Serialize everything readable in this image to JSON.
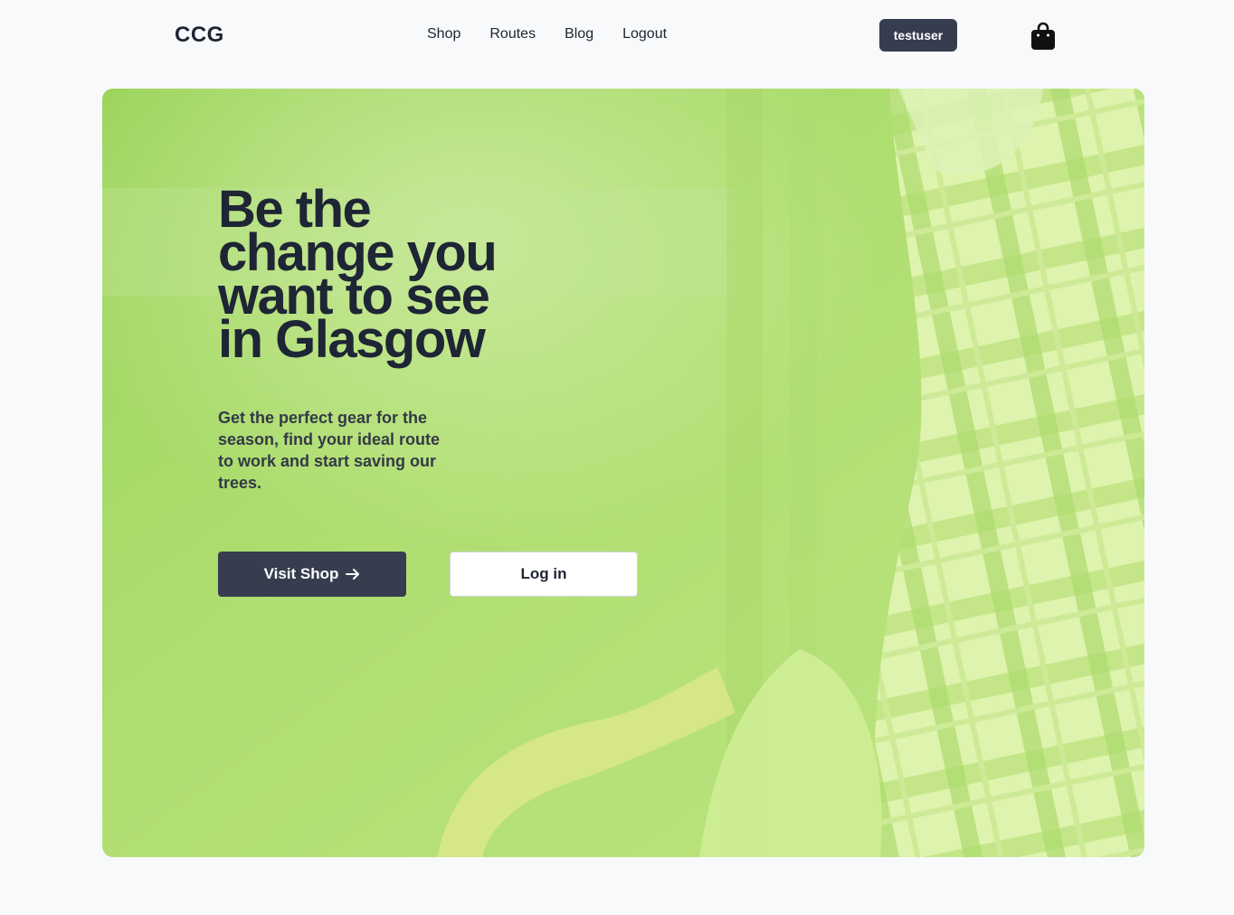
{
  "brand": {
    "logo": "CCG"
  },
  "nav": {
    "links": [
      {
        "label": "Shop"
      },
      {
        "label": "Routes"
      },
      {
        "label": "Blog"
      },
      {
        "label": "Logout"
      }
    ],
    "username": "testuser",
    "cart_icon": "shopping-bag-icon"
  },
  "hero": {
    "title": "Be the change you want to see in Glasgow",
    "subtitle": "Get the perfect gear for the season, find your ideal route to work and start saving our trees.",
    "primary_button": "Visit Shop",
    "primary_button_icon": "arrow-right-icon",
    "secondary_button": "Log in",
    "overlay_color": "#b8e986"
  },
  "colors": {
    "accent_dark": "#363d4f",
    "text": "#1f2433",
    "background": "#f8f9fb"
  }
}
